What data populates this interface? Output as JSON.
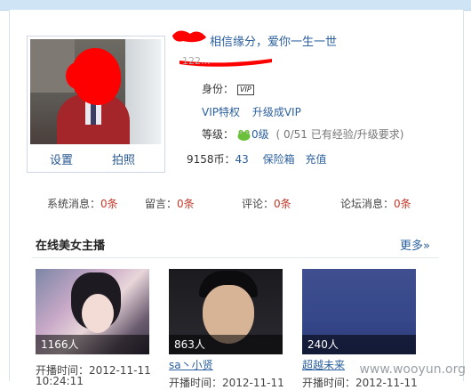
{
  "profile": {
    "username": "相信缘分，爱你一生一世",
    "userid_fragment": "122...",
    "identity_label": "身份：",
    "vip_badge": "VIP",
    "vip_privilege": "VIP特权",
    "upgrade_vip": "升级成VIP",
    "level_label": "等级：",
    "level_value": "0级",
    "level_progress": "( 0/51 已有经验/升级要求)",
    "coins_label": "9158币：",
    "coins_value": "43",
    "safe_box": "保险箱",
    "recharge": "充值",
    "settings": "设置",
    "take_photo": "拍照"
  },
  "messages": [
    {
      "label": "系统消息：",
      "count": "0条"
    },
    {
      "label": "留言：",
      "count": "0条"
    },
    {
      "label": "评论：",
      "count": "0条"
    },
    {
      "label": "论坛消息：",
      "count": "0条"
    }
  ],
  "live": {
    "title": "在线美女主播",
    "more": "更多»",
    "cards": [
      {
        "count": "1166人",
        "name": "",
        "time": "开播时间：2012-11-11",
        "time2": "10:24:11"
      },
      {
        "count": "863人",
        "name": "sa丶小贤",
        "time": "开播时间：2012-11-11",
        "time2": ""
      },
      {
        "count": "240人",
        "name": "超越未来",
        "time": "开播时间：2012-11-11",
        "time2": ""
      }
    ]
  },
  "watermark": "www.wooyun.org",
  "colors": {
    "link": "#2b5f9e",
    "count": "#c0392b",
    "redaction": "#ff0000"
  }
}
